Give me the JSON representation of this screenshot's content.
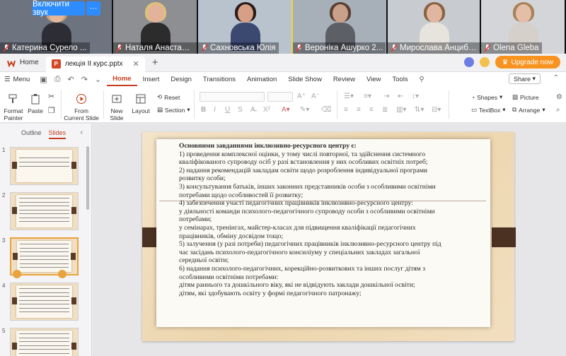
{
  "conference": {
    "sound_button": "Включити звук",
    "more_button": "···",
    "participants": [
      {
        "name": "Катерина Сурело ...",
        "bg": "#6d7480",
        "hair": "#c9a37a",
        "body": "#2d2d35",
        "skin": "#e4b69a",
        "active": false
      },
      {
        "name": "Наталя Анастасова",
        "bg": "#8e8f93",
        "hair": "#e0c07a",
        "body": "#2c2c2c",
        "skin": "#e2b39a",
        "active": false
      },
      {
        "name": "Сахновська Юлія",
        "bg": "#b9c3ce",
        "hair": "#2a1e1a",
        "body": "#3b4870",
        "skin": "#d79f86",
        "active": true
      },
      {
        "name": "Вероніка Ашурко 2...",
        "bg": "#a7afb8",
        "hair": "#5a4034",
        "body": "#5d5f66",
        "skin": "#c9a08a",
        "active": false
      },
      {
        "name": "Мирослава Анцибор",
        "bg": "#c8cbcf",
        "hair": "#8a6244",
        "body": "#e7e3dd",
        "skin": "#e1b6a0",
        "active": false
      },
      {
        "name": "Olena Gleba",
        "bg": "#d3d5d8",
        "hair": "#a78258",
        "body": "#d6d0cb",
        "skin": "#e4bea7",
        "active": false
      }
    ]
  },
  "tabs": {
    "home": "Home",
    "document": "лекція ІІ курс.pptx",
    "upgrade": "Upgrade now"
  },
  "ribbon": {
    "menu": "Menu",
    "tabs": [
      "Home",
      "Insert",
      "Design",
      "Transitions",
      "Animation",
      "Slide Show",
      "Review",
      "View",
      "Tools"
    ],
    "active_tab": "Home",
    "share": "Share"
  },
  "toolbar": {
    "format_painter": "Format Painter",
    "paste": "Paste",
    "from_current_slide": "From Current Slide",
    "new_slide": "New Slide",
    "layout": "Layout",
    "reset": "Reset",
    "section": "Section",
    "shapes": "Shapes",
    "picture": "Picture",
    "textbox": "TextBox",
    "arrange": "Arrange"
  },
  "left_panel": {
    "outline_tab": "Outline",
    "slides_tab": "Slides",
    "thumbnails": [
      "1",
      "2",
      "3",
      "4",
      "5"
    ],
    "selected": "3"
  },
  "slide": {
    "title": "Основними завданнями інклюзивно-ресурсного центру є:",
    "lines": [
      "1) проведення комплексної оцінки, у тому числі повторної, та здійснення системного",
      "кваліфікованого супроводу осіб у разі встановлення у них особливих освітніх потреб;",
      "2) надання рекомендацій закладам освіти щодо розроблення індивідуальної програми",
      "розвитку особи;",
      "3) консультування батьків, інших законних представників особи з особливими освітніми",
      "потребами щодо особливостей її розвитку;",
      "4) забезпечення участі педагогічних працівників інклюзивно-ресурсного центру:",
      "у діяльності команди психолого-педагогічного супроводу особи з особливими освітніми",
      "потребами;",
      "у семінарах, тренінгах, майстер-класах для підвищення кваліфікації педагогічних",
      "працівників, обміну досвідом тощо;",
      "5) залучення (у разі потреби) педагогічних працівників інклюзивно-ресурсного центру під",
      "час засідань психолого-педагогічного консиліуму у спеціальних закладах загальної",
      "середньої освіти;",
      "6) надання психолого-педагогічних, корекційно-розвиткових та інших послуг дітям з",
      "особливими освітніми потребами:",
      "дітям раннього та дошкільного віку, які не відвідують заклади дошкільної освіти;",
      "дітям, які здобувають освіту у формі педагогічного патронажу;"
    ]
  },
  "colors": {
    "accent": "#c43e1c",
    "upgrade": "#f7931e",
    "zoom_blue": "#2d8cff",
    "slide_tab": "#4a3122"
  }
}
